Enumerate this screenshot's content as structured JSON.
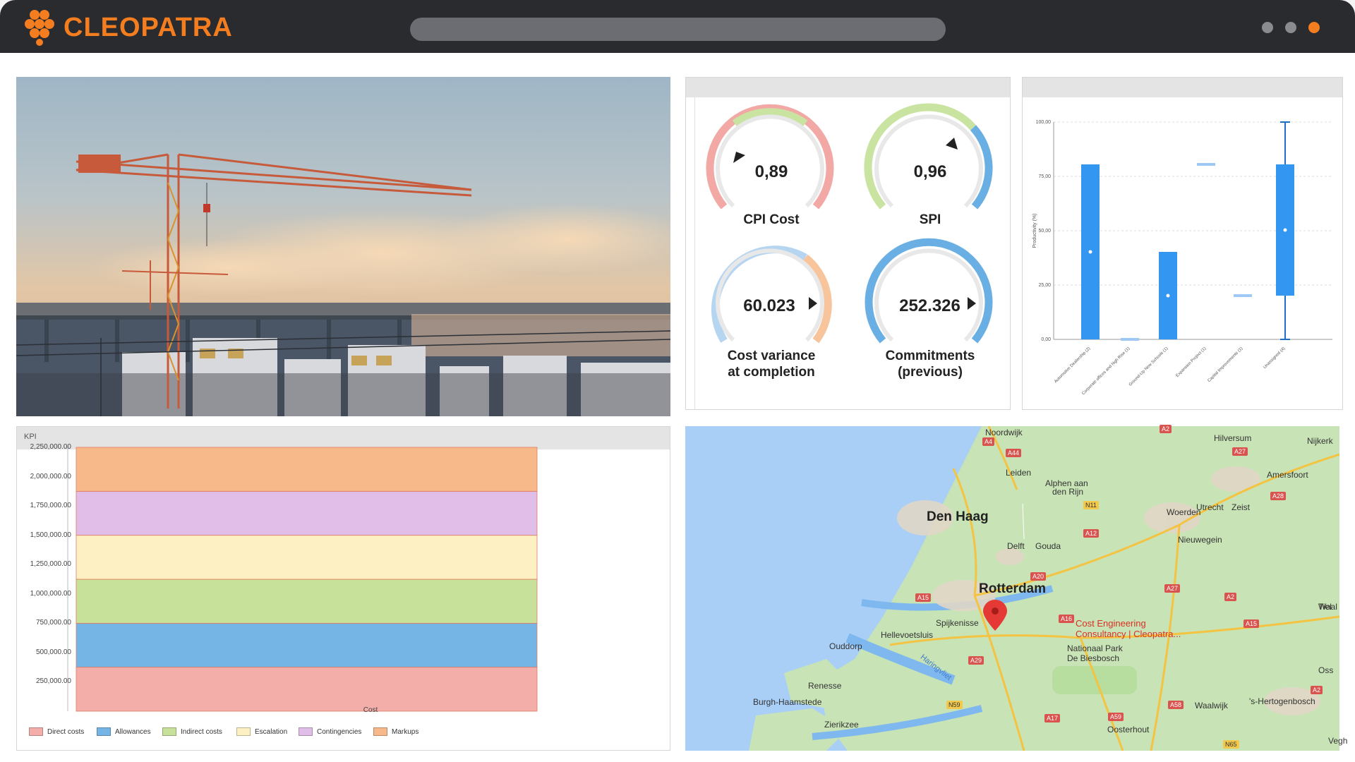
{
  "app": {
    "brand": "CLEOPATRA",
    "colors": {
      "accent": "#f47d20",
      "bar": "#2a2b2f"
    }
  },
  "window": {
    "dots": [
      "#8a8b8f",
      "#8a8b8f",
      "#f47d20"
    ]
  },
  "gauges": [
    {
      "value": "0,89",
      "label_lines": [
        "CPI Cost"
      ],
      "pointer": "left"
    },
    {
      "value": "0,96",
      "label_lines": [
        "SPI"
      ],
      "pointer": "right"
    },
    {
      "value": "60.023",
      "label_lines": [
        "Cost variance",
        "at completion"
      ],
      "pointer": "right-arrow"
    },
    {
      "value": "252.326",
      "label_lines": [
        "Commitments",
        "(previous)"
      ],
      "pointer": "right-arrow"
    }
  ],
  "boxplot": {
    "ylabel": "Productivity (%)",
    "ticks": [
      "0,00",
      "25,00",
      "50,00",
      "75,00",
      "100,00"
    ],
    "categories": [
      "Automotive Dealership (2)",
      "Corporate offices and high Rise (1)",
      "Ground-Up New Schools (1)",
      "Expansion Project (1)",
      "Capital Improvements (1)",
      "Unassigned (4)"
    ]
  },
  "chart_data": {
    "type": "bar",
    "stacked": true,
    "title": "KPI",
    "xlabel": "Cost",
    "categories": [
      "Cost"
    ],
    "ylim": [
      0,
      2250000
    ],
    "y_ticks": [
      "250,000.00",
      "500,000.00",
      "750,000.00",
      "1,000,000.00",
      "1,250,000.00",
      "1,500,000.00",
      "1,750,000.00",
      "2,000,000.00",
      "2,250,000.00"
    ],
    "series": [
      {
        "name": "Direct costs",
        "values": [
          375000
        ],
        "color": "#f4aeaa"
      },
      {
        "name": "Allowances",
        "values": [
          375000
        ],
        "color": "#74b5e6"
      },
      {
        "name": "Indirect costs",
        "values": [
          375000
        ],
        "color": "#c7e19b"
      },
      {
        "name": "Escalation",
        "values": [
          375000
        ],
        "color": "#fdf0c3"
      },
      {
        "name": "Contingencies",
        "values": [
          375000
        ],
        "color": "#e1bee7"
      },
      {
        "name": "Markups",
        "values": [
          375000
        ],
        "color": "#f8b98a"
      }
    ]
  },
  "map": {
    "cities": [
      "Den Haag",
      "Rotterdam"
    ],
    "places": [
      "Noordwijk",
      "Leiden",
      "Alphen aan",
      "den Rijn",
      "Hilversum",
      "Nijkerk",
      "Amersfoort",
      "Utrecht",
      "Zeist",
      "Woerden",
      "Delft",
      "Gouda",
      "Nieuwegein",
      "Spijkenisse",
      "Hellevoetsluis",
      "Ouddorp",
      "Renesse",
      "Burgh-Haamstede",
      "Zierikzee",
      "Oosterhout",
      "Waalwijk",
      "'s-Hertogenbosch",
      "Tiel",
      "Oss",
      "Nationaal Park",
      "De Biesbosch",
      "Haringvliet",
      "Waal",
      "Vegh"
    ],
    "roads": [
      "A44",
      "A4",
      "A2",
      "A27",
      "N11",
      "A12",
      "A28",
      "A20",
      "A15",
      "A16",
      "A29",
      "N59",
      "A17",
      "A59",
      "A58",
      "A2",
      "N65",
      "A27",
      "A2",
      "A15"
    ],
    "marker_title_lines": [
      "Cost Engineering",
      "Consultancy | Cleopatra..."
    ]
  }
}
